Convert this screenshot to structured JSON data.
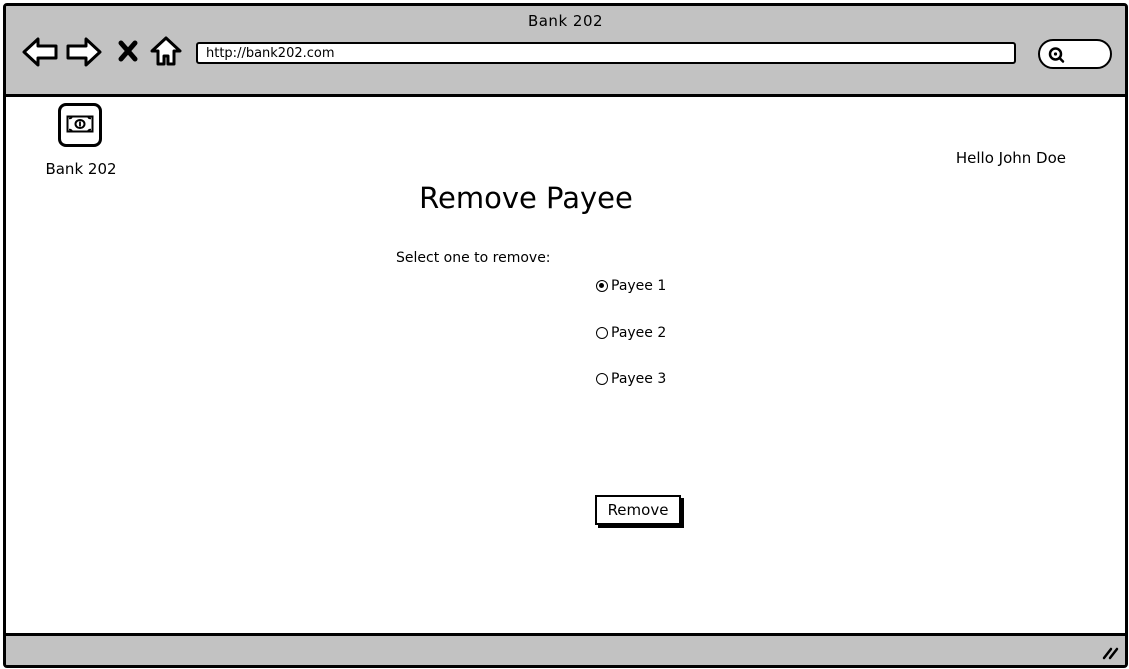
{
  "window": {
    "title": "Bank 202"
  },
  "browser": {
    "url": "http://bank202.com",
    "icons": {
      "back": "back-arrow-icon",
      "forward": "forward-arrow-icon",
      "stop": "close-icon",
      "home": "home-icon",
      "search": "search-icon"
    }
  },
  "header": {
    "logo_label": "Bank 202",
    "greeting": "Hello John Doe"
  },
  "main": {
    "title": "Remove Payee",
    "select_label": "Select one to remove:",
    "payees": [
      {
        "label": "Payee 1",
        "selected": true
      },
      {
        "label": "Payee 2",
        "selected": false
      },
      {
        "label": "Payee 3",
        "selected": false
      }
    ],
    "remove_label": "Remove"
  },
  "colors": {
    "chrome": "#c2c2c2",
    "border": "#000000",
    "background": "#ffffff"
  }
}
